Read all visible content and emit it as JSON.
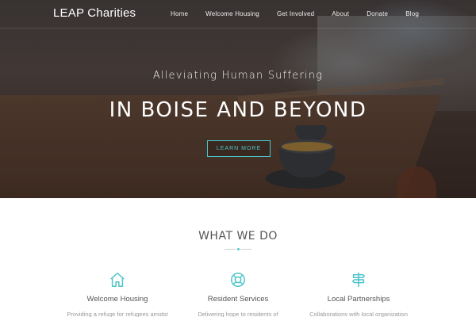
{
  "nav": {
    "brand": "LEAP Charities",
    "items": [
      {
        "label": "Home"
      },
      {
        "label": "Welcome Housing"
      },
      {
        "label": "Get Involved"
      },
      {
        "label": "About"
      },
      {
        "label": "Donate"
      },
      {
        "label": "Blog"
      }
    ]
  },
  "hero": {
    "subtitle": "Alleviating Human Suffering",
    "title": "IN BOISE AND BEYOND",
    "cta_label": "LEARN MORE"
  },
  "what_we_do": {
    "title": "WHAT WE DO",
    "features": [
      {
        "title": "Welcome Housing",
        "text": "Providing a refuge for refugees amidst",
        "icon": "home-icon"
      },
      {
        "title": "Resident Services",
        "text": "Delivering hope to residents of",
        "icon": "life-ring-icon"
      },
      {
        "title": "Local Partnerships",
        "text": "Collaborations with local organization",
        "icon": "signpost-icon"
      }
    ]
  },
  "colors": {
    "accent": "#4cc4c9",
    "heading": "#555555",
    "body_text": "#9a9a9a"
  }
}
